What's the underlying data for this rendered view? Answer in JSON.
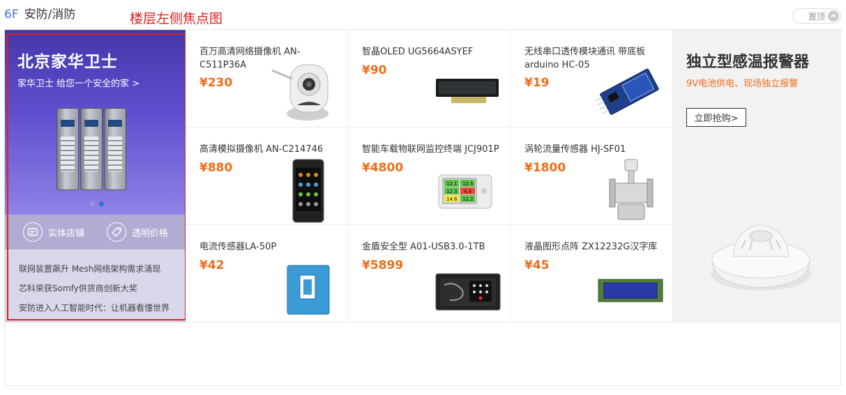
{
  "floor": {
    "number": "6F",
    "title": "安防/消防",
    "annotation": "楼层左侧焦点图",
    "top_button": "置顶"
  },
  "focus": {
    "brand": "北京家华卫士",
    "slogan": "家华卫士  给您一个安全的家  >",
    "services": [
      {
        "label": "实体店铺",
        "icon": "store-icon"
      },
      {
        "label": "透明价格",
        "icon": "price-tag-icon"
      }
    ],
    "news": [
      "联网装置飙升 Mesh网络架构需求涌现",
      "芯科荣获Somfy供货商创新大奖",
      "安防进入人工智能时代：让机器看懂世界"
    ]
  },
  "products": [
    {
      "name": "百万高清网络摄像机 AN-C511P36A",
      "price": "¥230",
      "icon": "webcam-icon"
    },
    {
      "name": "智晶OLED UG5664ASYEF",
      "price": "¥90",
      "icon": "oled-module-icon"
    },
    {
      "name": "无线串口透传模块通讯 带底板arduino HC-05",
      "price": "¥19",
      "icon": "bluetooth-module-icon"
    },
    {
      "name": "高清模拟摄像机 AN-C214746",
      "price": "¥880",
      "icon": "monitor-device-icon"
    },
    {
      "name": "智能车载物联网监控终端 JCJ901P",
      "price": "¥4800",
      "icon": "terminal-display-icon"
    },
    {
      "name": "涡轮流量传感器 HJ-SF01",
      "price": "¥1800",
      "icon": "flow-sensor-icon"
    },
    {
      "name": "电流传感器LA-50P",
      "price": "¥42",
      "icon": "current-sensor-icon"
    },
    {
      "name": "金盾安全型 A01-USB3.0-1TB",
      "price": "¥5899",
      "icon": "secure-drive-case-icon"
    },
    {
      "name": "液晶图形点阵 ZX12232G汉字库",
      "price": "¥45",
      "icon": "lcd-module-icon"
    }
  ],
  "ad": {
    "title": "独立型感温报警器",
    "subtitle": "9V电池供电、现场独立报警",
    "button": "立即抢购>",
    "icon": "smoke-detector-icon"
  },
  "terminal_readout": {
    "cells": [
      "12.1",
      "12.5",
      "12.3",
      "4.4",
      "14.6",
      "12.2"
    ]
  },
  "colors": {
    "accent": "#3f76c8",
    "price": "#ef6c1a",
    "annotation": "#e02020",
    "banner": "#4f43c0"
  }
}
